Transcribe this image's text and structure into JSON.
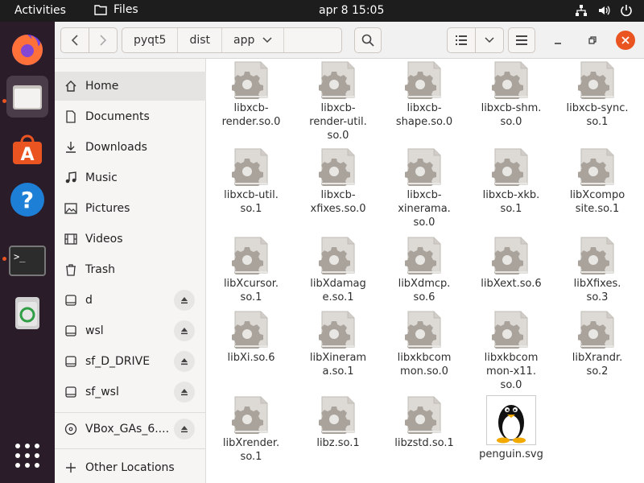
{
  "topbar": {
    "activities": "Activities",
    "app_name": "Files",
    "clock": "apr 8  15:05"
  },
  "dock": {
    "items": [
      "firefox-icon",
      "files-icon",
      "app-center-icon",
      "help-icon",
      "terminal-icon",
      "trash-icon"
    ],
    "show_apps": "show-apps-icon"
  },
  "header": {
    "breadcrumbs": [
      "pyqt5",
      "dist",
      "app"
    ]
  },
  "sidebar": {
    "places": [
      {
        "label": "Home",
        "icon": "home-icon"
      },
      {
        "label": "Documents",
        "icon": "documents-icon"
      },
      {
        "label": "Downloads",
        "icon": "downloads-icon"
      },
      {
        "label": "Music",
        "icon": "music-icon"
      },
      {
        "label": "Pictures",
        "icon": "pictures-icon"
      },
      {
        "label": "Videos",
        "icon": "videos-icon"
      },
      {
        "label": "Trash",
        "icon": "trash-icon"
      }
    ],
    "drives": [
      {
        "label": "d"
      },
      {
        "label": "wsl"
      },
      {
        "label": "sf_D_DRIVE"
      },
      {
        "label": "sf_wsl"
      }
    ],
    "disc": {
      "label": "VBox_GAs_6...."
    },
    "other_locations": "Other Locations"
  },
  "files": [
    {
      "name": "libxcb-\nrender.so.0",
      "type": "library"
    },
    {
      "name": "libxcb-\nrender-util.\nso.0",
      "type": "library"
    },
    {
      "name": "libxcb-\nshape.so.0",
      "type": "library"
    },
    {
      "name": "libxcb-shm.\nso.0",
      "type": "library"
    },
    {
      "name": "libxcb-sync.\nso.1",
      "type": "library"
    },
    {
      "name": "libxcb-util.\nso.1",
      "type": "library"
    },
    {
      "name": "libxcb-\nxfixes.so.0",
      "type": "library"
    },
    {
      "name": "libxcb-\nxinerama.\nso.0",
      "type": "library"
    },
    {
      "name": "libxcb-xkb.\nso.1",
      "type": "library"
    },
    {
      "name": "libXcompo\nsite.so.1",
      "type": "library"
    },
    {
      "name": "libXcursor.\nso.1",
      "type": "library"
    },
    {
      "name": "libXdamag\ne.so.1",
      "type": "library"
    },
    {
      "name": "libXdmcp.\nso.6",
      "type": "library"
    },
    {
      "name": "libXext.so.6",
      "type": "library"
    },
    {
      "name": "libXfixes.\nso.3",
      "type": "library"
    },
    {
      "name": "libXi.so.6",
      "type": "library"
    },
    {
      "name": "libXineram\na.so.1",
      "type": "library"
    },
    {
      "name": "libxkbcom\nmon.so.0",
      "type": "library"
    },
    {
      "name": "libxkbcom\nmon-x11.\nso.0",
      "type": "library"
    },
    {
      "name": "libXrandr.\nso.2",
      "type": "library"
    },
    {
      "name": "libXrender.\nso.1",
      "type": "library"
    },
    {
      "name": "libz.so.1",
      "type": "library"
    },
    {
      "name": "libzstd.so.1",
      "type": "library"
    },
    {
      "name": "penguin.svg",
      "type": "image"
    }
  ],
  "colors": {
    "accent": "#e95420",
    "close": "#e95420"
  }
}
